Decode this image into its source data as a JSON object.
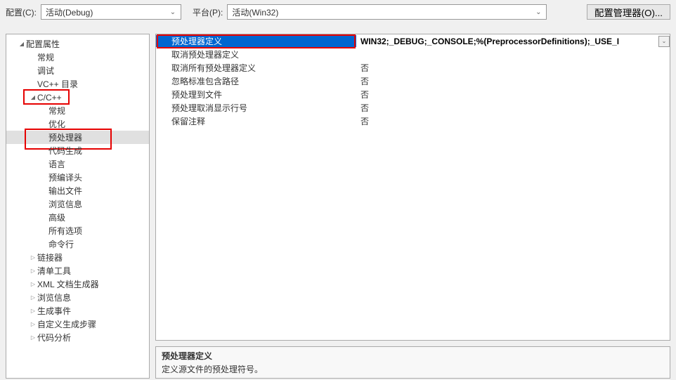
{
  "topBar": {
    "configLabel": "配置(C):",
    "configValue": "活动(Debug)",
    "platformLabel": "平台(P):",
    "platformValue": "活动(Win32)",
    "configMgrBtn": "配置管理器(O)..."
  },
  "tree": {
    "root": "配置属性",
    "items": [
      {
        "label": "常规",
        "level": 2,
        "arrow": "none"
      },
      {
        "label": "调试",
        "level": 2,
        "arrow": "none"
      },
      {
        "label": "VC++ 目录",
        "level": 2,
        "arrow": "none"
      },
      {
        "label": "C/C++",
        "level": 2,
        "arrow": "expanded",
        "redbox": true
      },
      {
        "label": "常规",
        "level": 3,
        "arrow": "none"
      },
      {
        "label": "优化",
        "level": 3,
        "arrow": "none"
      },
      {
        "label": "预处理器",
        "level": 3,
        "arrow": "none",
        "selected": true,
        "redbox": true
      },
      {
        "label": "代码生成",
        "level": 3,
        "arrow": "none"
      },
      {
        "label": "语言",
        "level": 3,
        "arrow": "none"
      },
      {
        "label": "预编译头",
        "level": 3,
        "arrow": "none"
      },
      {
        "label": "输出文件",
        "level": 3,
        "arrow": "none"
      },
      {
        "label": "浏览信息",
        "level": 3,
        "arrow": "none"
      },
      {
        "label": "高级",
        "level": 3,
        "arrow": "none"
      },
      {
        "label": "所有选项",
        "level": 3,
        "arrow": "none"
      },
      {
        "label": "命令行",
        "level": 3,
        "arrow": "none"
      },
      {
        "label": "链接器",
        "level": 2,
        "arrow": "collapsed"
      },
      {
        "label": "清单工具",
        "level": 2,
        "arrow": "collapsed"
      },
      {
        "label": "XML 文档生成器",
        "level": 2,
        "arrow": "collapsed"
      },
      {
        "label": "浏览信息",
        "level": 2,
        "arrow": "collapsed"
      },
      {
        "label": "生成事件",
        "level": 2,
        "arrow": "collapsed"
      },
      {
        "label": "自定义生成步骤",
        "level": 2,
        "arrow": "collapsed"
      },
      {
        "label": "代码分析",
        "level": 2,
        "arrow": "collapsed"
      }
    ]
  },
  "props": {
    "rows": [
      {
        "label": "预处理器定义",
        "value": "WIN32;_DEBUG;_CONSOLE;%(PreprocessorDefinitions);_USE_I",
        "selected": true,
        "dropdown": true,
        "redbox": true
      },
      {
        "label": "取消预处理器定义",
        "value": ""
      },
      {
        "label": "取消所有预处理器定义",
        "value": "否"
      },
      {
        "label": "忽略标准包含路径",
        "value": "否"
      },
      {
        "label": "预处理到文件",
        "value": "否"
      },
      {
        "label": "预处理取消显示行号",
        "value": "否"
      },
      {
        "label": "保留注释",
        "value": "否"
      }
    ]
  },
  "desc": {
    "title": "预处理器定义",
    "text": "定义源文件的预处理符号。"
  }
}
